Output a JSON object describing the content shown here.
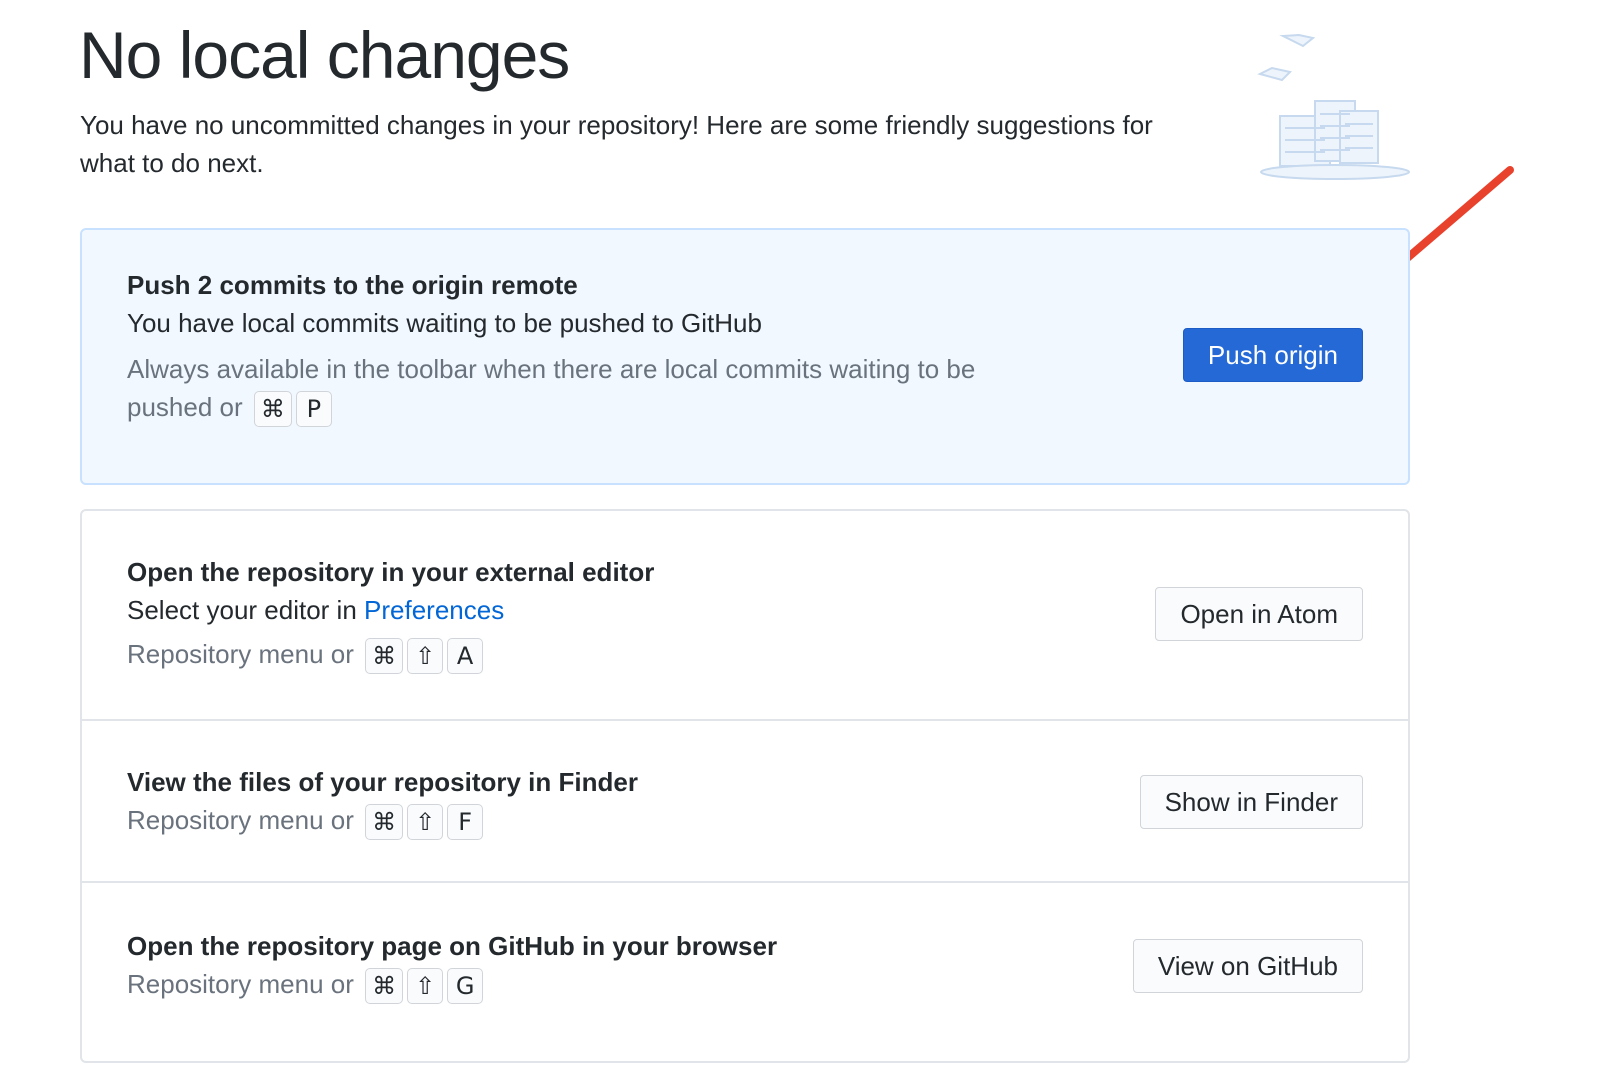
{
  "header": {
    "title": "No local changes",
    "subtitle": "You have no uncommitted changes in your repository! Here are some friendly suggestions for what to do next."
  },
  "push": {
    "title": "Push 2 commits to the origin remote",
    "description": "You have local commits waiting to be pushed to GitHub",
    "hint": "Always available in the toolbar when there are local commits waiting to be pushed or",
    "keys": [
      "⌘",
      "P"
    ],
    "button_label": "Push origin"
  },
  "editor": {
    "title": "Open the repository in your external editor",
    "description_prefix": "Select your editor in ",
    "description_link": "Preferences",
    "hint": "Repository menu or",
    "keys": [
      "⌘",
      "⇧",
      "A"
    ],
    "button_label": "Open in Atom"
  },
  "finder": {
    "title": "View the files of your repository in Finder",
    "hint": "Repository menu or",
    "keys": [
      "⌘",
      "⇧",
      "F"
    ],
    "button_label": "Show in Finder"
  },
  "github": {
    "title": "Open the repository page on GitHub in your browser",
    "hint": "Repository menu or",
    "keys": [
      "⌘",
      "⇧",
      "G"
    ],
    "button_label": "View on GitHub"
  },
  "icons": {
    "illustration": "paper-stacks-illustration-icon",
    "annotation": "red-arrow-icon"
  },
  "colors": {
    "accent": "#2469d6",
    "link": "#0366d6",
    "annotation": "#e8412c",
    "primary_card_bg": "#f1f8ff"
  }
}
